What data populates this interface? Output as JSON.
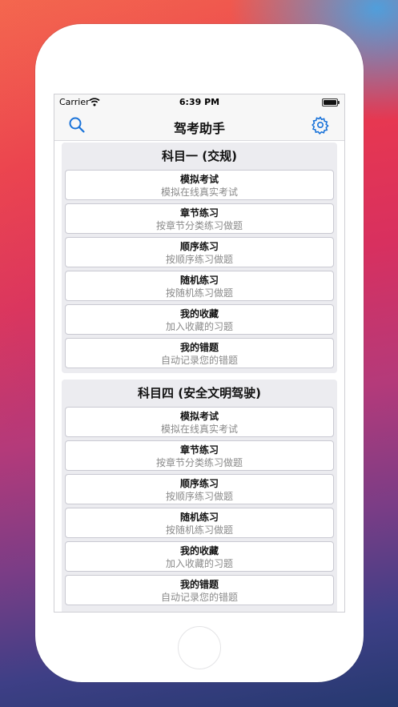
{
  "status_bar": {
    "carrier": "Carrier",
    "time": "6:39 PM"
  },
  "nav": {
    "title": "驾考助手",
    "search_icon": "search-icon",
    "settings_icon": "gear-icon"
  },
  "sections": [
    {
      "title": "科目一 (交规)",
      "items": [
        {
          "title": "模拟考试",
          "subtitle": "模拟在线真实考试"
        },
        {
          "title": "章节练习",
          "subtitle": "按章节分类练习做题"
        },
        {
          "title": "顺序练习",
          "subtitle": "按顺序练习做题"
        },
        {
          "title": "随机练习",
          "subtitle": "按随机练习做题"
        },
        {
          "title": "我的收藏",
          "subtitle": "加入收藏的习题"
        },
        {
          "title": "我的错题",
          "subtitle": "自动记录您的错题"
        }
      ]
    },
    {
      "title": "科目四 (安全文明驾驶)",
      "items": [
        {
          "title": "模拟考试",
          "subtitle": "模拟在线真实考试"
        },
        {
          "title": "章节练习",
          "subtitle": "按章节分类练习做题"
        },
        {
          "title": "顺序练习",
          "subtitle": "按顺序练习做题"
        },
        {
          "title": "随机练习",
          "subtitle": "按随机练习做题"
        },
        {
          "title": "我的收藏",
          "subtitle": "加入收藏的习题"
        },
        {
          "title": "我的错题",
          "subtitle": "自动记录您的错题"
        }
      ]
    }
  ],
  "colors": {
    "accent": "#1a73d9",
    "section_bg": "#ececf0",
    "subtitle": "#8a8a8a"
  }
}
